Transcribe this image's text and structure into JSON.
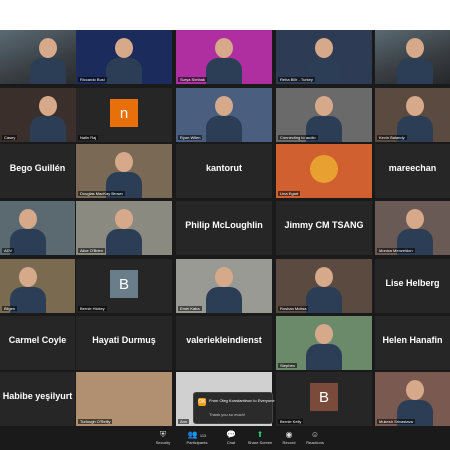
{
  "participants": [
    {
      "name": "",
      "display": "",
      "kind": "video",
      "color": "#3b5a6e"
    },
    {
      "name": "Riccardo Busi",
      "display": "",
      "kind": "video",
      "color": "#1a2b5c"
    },
    {
      "name": "Surya Simbak",
      "display": "",
      "kind": "video",
      "color": "#b02fa0"
    },
    {
      "name": "Reha Bilir - Turkey",
      "display": "",
      "kind": "video",
      "color": "#2d3b55"
    },
    {
      "name": "",
      "display": "",
      "kind": "video",
      "color": "#5b6a60"
    },
    {
      "name": "Casey",
      "display": "",
      "kind": "video",
      "color": "#3a2f2a"
    },
    {
      "name": "Nalin Raj",
      "display": "",
      "kind": "avatar",
      "letter": "n",
      "color": "#e8700a"
    },
    {
      "name": "Ryon Wilen",
      "display": "",
      "kind": "video",
      "color": "#4a5f80"
    },
    {
      "name": "Connecting to audio",
      "display": "",
      "kind": "video",
      "color": "#6a6a6a"
    },
    {
      "name": "Kevin Balandy",
      "display": "",
      "kind": "video",
      "color": "#5a4a40"
    },
    {
      "name": "",
      "display": "Bego Guillén",
      "kind": "name"
    },
    {
      "name": "Douglas MacKay Brown",
      "display": "",
      "kind": "video",
      "color": "#7a6a55"
    },
    {
      "name": "",
      "display": "kantorut",
      "kind": "name"
    },
    {
      "name": "Lina Egart",
      "display": "",
      "kind": "video",
      "color": "#d06030"
    },
    {
      "name": "",
      "display": "mareechan",
      "kind": "name"
    },
    {
      "name": "ADV",
      "display": "",
      "kind": "video",
      "color": "#5a6a70"
    },
    {
      "name": "Alice O'Brien",
      "display": "",
      "kind": "video",
      "color": "#8a8a80"
    },
    {
      "name": "",
      "display": "Philip McLoughlin",
      "kind": "name"
    },
    {
      "name": "",
      "display": "Jimmy CM TSANG",
      "kind": "name"
    },
    {
      "name": "Monica Menzeldon",
      "display": "",
      "kind": "video",
      "color": "#6a5a55"
    },
    {
      "name": "Bilgen",
      "display": "",
      "kind": "video",
      "color": "#7a6a50"
    },
    {
      "name": "Bernie Hickey",
      "display": "",
      "kind": "avatar",
      "letter": "B",
      "color": "#6a7d8a"
    },
    {
      "name": "Emel Kaba",
      "display": "",
      "kind": "video",
      "color": "#9a9a95"
    },
    {
      "name": "Roshan Mcltsa",
      "display": "",
      "kind": "video",
      "color": "#5a4a40"
    },
    {
      "name": "",
      "display": "Lise Helberg",
      "kind": "name"
    },
    {
      "name": "",
      "display": "Carmel Coyle",
      "kind": "name"
    },
    {
      "name": "",
      "display": "Hayati Durmuş",
      "kind": "name"
    },
    {
      "name": "",
      "display": "valeriekleindienst",
      "kind": "name"
    },
    {
      "name": "Stephen",
      "display": "",
      "kind": "video",
      "color": "#6a8a6a"
    },
    {
      "name": "",
      "display": "Helen Hanafin",
      "kind": "name"
    },
    {
      "name": "",
      "display": "Habibe yeşilyurt",
      "kind": "name"
    },
    {
      "name": "Turlough O'Reilly",
      "display": "",
      "kind": "video",
      "color": "#b09070"
    },
    {
      "name": "Ann",
      "display": "",
      "kind": "video",
      "color": "#d0d0d0"
    },
    {
      "name": "Bernie Kelly",
      "display": "",
      "kind": "avatar",
      "letter": "B",
      "color": "#7a4a3a"
    },
    {
      "name": "Mukesh Srivastava",
      "display": "",
      "kind": "video",
      "color": "#7a5a50"
    }
  ],
  "toolbar": {
    "items": [
      {
        "icon": "shield",
        "label": "Security"
      },
      {
        "icon": "people",
        "label": "Participants",
        "count": "113"
      },
      {
        "icon": "chat",
        "label": "Chat"
      },
      {
        "icon": "share-screen",
        "label": "Share Screen"
      },
      {
        "icon": "record",
        "label": "Record"
      },
      {
        "icon": "reactions",
        "label": "Reactions"
      }
    ]
  },
  "chat_popup": {
    "avatar_letter": "OK",
    "from": "From Oleg Konstantinov to Everyone",
    "message": "Thank you so much!"
  },
  "accent_color": "#2d8cff"
}
